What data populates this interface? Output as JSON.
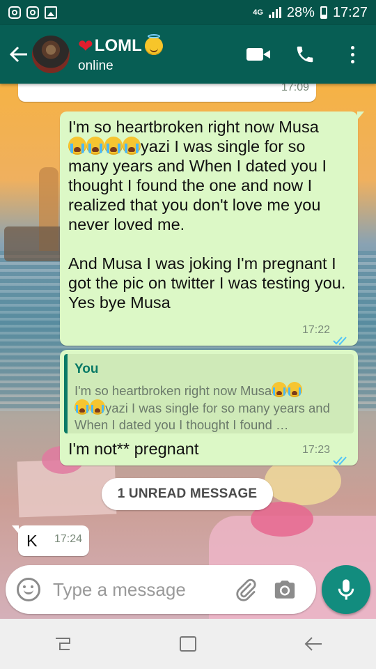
{
  "status_bar": {
    "network": "4G",
    "battery": "28%",
    "time": "17:27"
  },
  "header": {
    "contact_name": "LOML",
    "status": "online"
  },
  "messages": {
    "partial_time": "17:09",
    "main": {
      "line1": "I'm so heartbroken right now Musa",
      "line2": "yazi I was single for so many years and When I dated you I thought I found the one and now I realized that you don't love me you never loved me.\n\nAnd Musa I was joking I'm pregnant I got the pic on twitter I was testing you.\nYes bye Musa",
      "time": "17:22"
    },
    "reply": {
      "quote_author": "You",
      "quote_line1": "I'm so heartbroken right now Musa",
      "quote_line2": "yazi I was single for so many years and When I dated you I thought I found …",
      "text": "I'm not** pregnant",
      "time": "17:23"
    },
    "unread_label": "1 UNREAD MESSAGE",
    "incoming": {
      "text": "K",
      "time": "17:24"
    }
  },
  "composer": {
    "placeholder": "Type a message"
  },
  "colors": {
    "header": "#075e54",
    "status_bar": "#06544a",
    "outgoing_bubble": "#dcf8c6",
    "incoming_bubble": "#ffffff",
    "accent": "#128c7e",
    "read_ticks": "#4fc3f7"
  },
  "icons": {
    "status_left": [
      "instagram-icon",
      "instagram-icon",
      "gallery-icon"
    ],
    "header": [
      "back-arrow-icon",
      "video-call-icon",
      "phone-icon",
      "more-options-icon"
    ],
    "composer": [
      "emoji-icon",
      "attach-icon",
      "camera-icon",
      "mic-icon"
    ],
    "nav": [
      "recents-icon",
      "home-icon",
      "back-icon"
    ]
  }
}
